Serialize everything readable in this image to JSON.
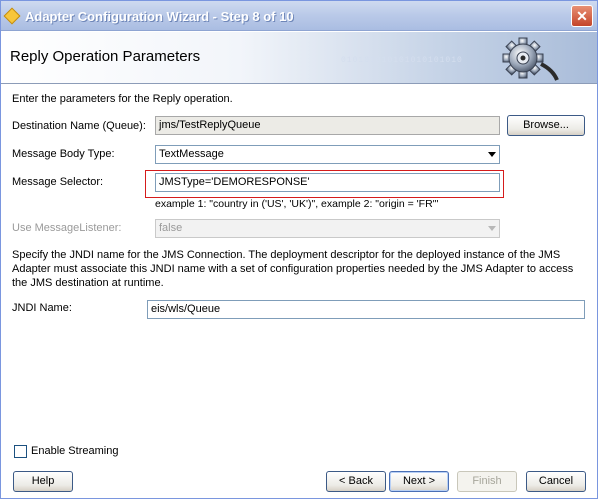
{
  "window": {
    "title": "Adapter Configuration Wizard - Step 8 of 10",
    "close_glyph": "✕"
  },
  "banner": {
    "title": "Reply Operation Parameters",
    "binary": "010101010101010101010",
    "icon": "gear-icon"
  },
  "form": {
    "intro": "Enter the parameters for the Reply operation.",
    "destination_label": "Destination Name (Queue):",
    "destination_value": "jms/TestReplyQueue",
    "browse_label": "Browse...",
    "body_type_label": "Message Body Type:",
    "body_type_value": "TextMessage",
    "selector_label": "Message Selector:",
    "selector_value": "JMSType='DEMORESPONSE'",
    "selector_example": "example 1: \"country in ('US', 'UK')\", example 2: \"origin = 'FR'\"",
    "listener_label": "Use MessageListener:",
    "listener_value": "false",
    "jndi_description": "Specify the JNDI name for the JMS Connection.  The deployment descriptor for the deployed instance of the JMS Adapter must associate this JNDI name with a set of configuration properties needed by the JMS Adapter to access the JMS destination at runtime.",
    "jndi_label": "JNDI Name:",
    "jndi_value": "eis/wls/Queue",
    "streaming_label": "Enable Streaming",
    "streaming_checked": false
  },
  "footer": {
    "help": "Help",
    "back": "< Back",
    "next": "Next >",
    "finish": "Finish",
    "cancel": "Cancel"
  },
  "colors": {
    "highlight_border": "#d51b1b",
    "title_bar": "#b9c9e8"
  }
}
